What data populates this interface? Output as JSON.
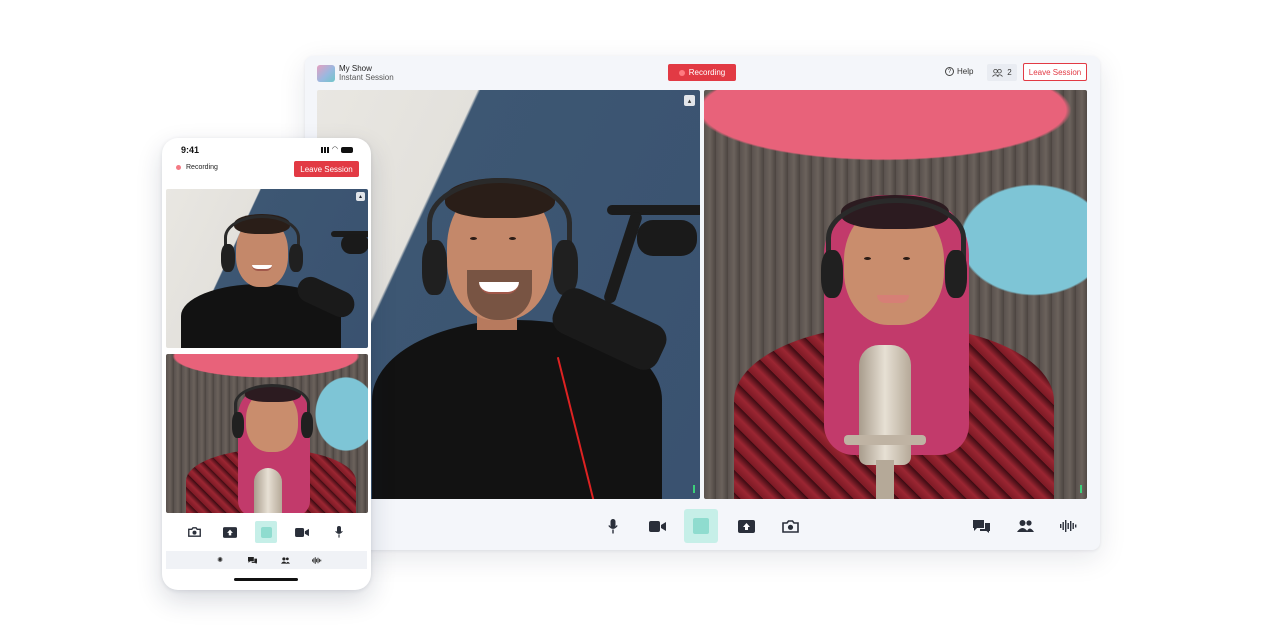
{
  "desktop": {
    "show_name": "My Show",
    "session_name": "Instant Session",
    "recording_label": "Recording",
    "help_label": "Help",
    "participant_count": "2",
    "leave_label": "Leave Session",
    "toolbar_left": [
      "mic-icon",
      "camera-icon",
      "stop-recording",
      "share-screen-icon",
      "snapshot-icon"
    ],
    "toolbar_right": [
      "chat-icon",
      "people-icon",
      "audio-levels-icon"
    ]
  },
  "phone": {
    "time": "9:41",
    "recording_label": "Recording",
    "leave_label": "Leave Session",
    "toolbar": [
      "snapshot-icon",
      "share-screen-icon",
      "stop-recording",
      "camera-icon",
      "mic-icon"
    ],
    "nav": [
      "settings-icon",
      "chat-icon",
      "people-icon",
      "audio-levels-icon"
    ]
  },
  "colors": {
    "accent_red": "#e23a44",
    "stop_teal": "#c6efe8",
    "window_bg": "#f4f6fa"
  }
}
